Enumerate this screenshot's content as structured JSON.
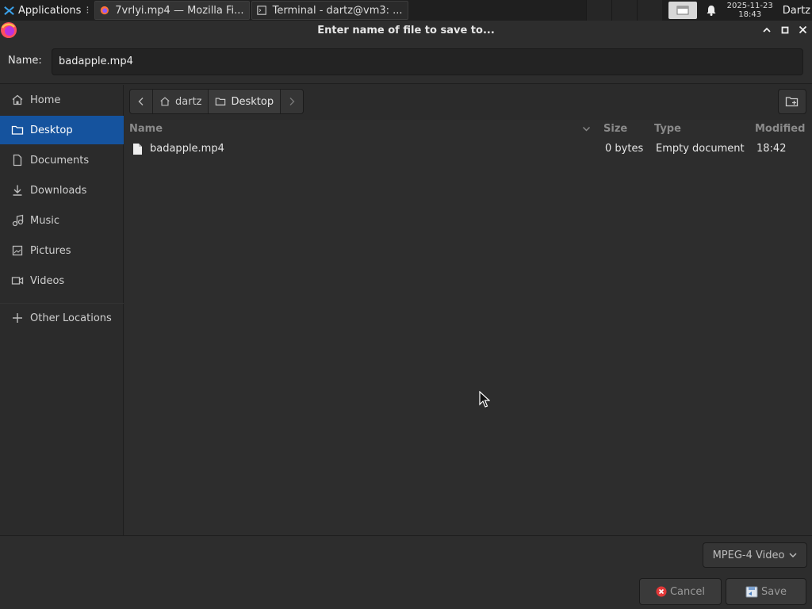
{
  "taskbar": {
    "apps_label": "Applications",
    "tasks": [
      {
        "label": "7vrlyi.mp4 — Mozilla Fi..."
      },
      {
        "label": "Terminal - dartz@vm3: ..."
      }
    ],
    "clock": {
      "date": "2025-11-23",
      "time": "18:43"
    },
    "user": "Dartz"
  },
  "dialog": {
    "title": "Enter name of file to save to...",
    "name_label": "Name:",
    "name_value": "badapple.mp4"
  },
  "sidebar": {
    "items": [
      {
        "label": "Home",
        "icon": "home-icon"
      },
      {
        "label": "Desktop",
        "icon": "folder-icon",
        "selected": true
      },
      {
        "label": "Documents",
        "icon": "document-icon"
      },
      {
        "label": "Downloads",
        "icon": "download-icon"
      },
      {
        "label": "Music",
        "icon": "music-icon"
      },
      {
        "label": "Pictures",
        "icon": "picture-icon"
      },
      {
        "label": "Videos",
        "icon": "video-icon"
      },
      {
        "label": "Other Locations",
        "icon": "plus-icon"
      }
    ]
  },
  "pathbar": {
    "crumbs": [
      {
        "label": "dartz",
        "icon": "home-icon"
      },
      {
        "label": "Desktop",
        "icon": "folder-icon"
      }
    ]
  },
  "filelist": {
    "columns": {
      "name": "Name",
      "size": "Size",
      "type": "Type",
      "modified": "Modified"
    },
    "rows": [
      {
        "name": "badapple.mp4",
        "size": "0 bytes",
        "type": "Empty document",
        "modified": "18:42"
      }
    ]
  },
  "footer": {
    "filter": "MPEG-4 Video",
    "cancel_label": "Cancel",
    "save_label": "Save"
  },
  "colors": {
    "selection": "#15539e",
    "background": "#2b2b2b"
  }
}
